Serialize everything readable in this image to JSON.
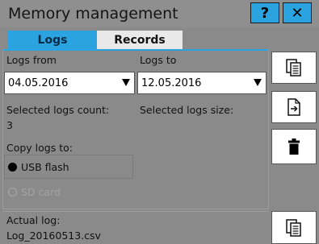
{
  "window": {
    "title": "Memory management",
    "help_label": "?",
    "close_label": "✕"
  },
  "tabs": [
    {
      "label": "Logs",
      "active": true
    },
    {
      "label": "Records",
      "active": false
    }
  ],
  "logs_from": {
    "label": "Logs from",
    "value": "04.05.2016"
  },
  "logs_to": {
    "label": "Logs to",
    "value": "12.05.2016"
  },
  "selected_count": {
    "label": "Selected logs count:",
    "value": "3"
  },
  "selected_size": {
    "label": "Selected logs size:",
    "value": ""
  },
  "copy_to": {
    "label": "Copy logs to:",
    "options": [
      {
        "label": "USB flash",
        "selected": true,
        "enabled": true
      },
      {
        "label": "SD card",
        "selected": false,
        "enabled": false
      }
    ]
  },
  "actual_log": {
    "label": "Actual log:",
    "value": "Log_20160513.csv"
  },
  "icons": {
    "copy_all": "copy-pages-icon",
    "export": "file-export-icon",
    "delete": "trash-icon",
    "copy_actual": "copy-pages-icon"
  },
  "colors": {
    "accent": "#2aa3e0",
    "background": "#8a8a8a"
  }
}
